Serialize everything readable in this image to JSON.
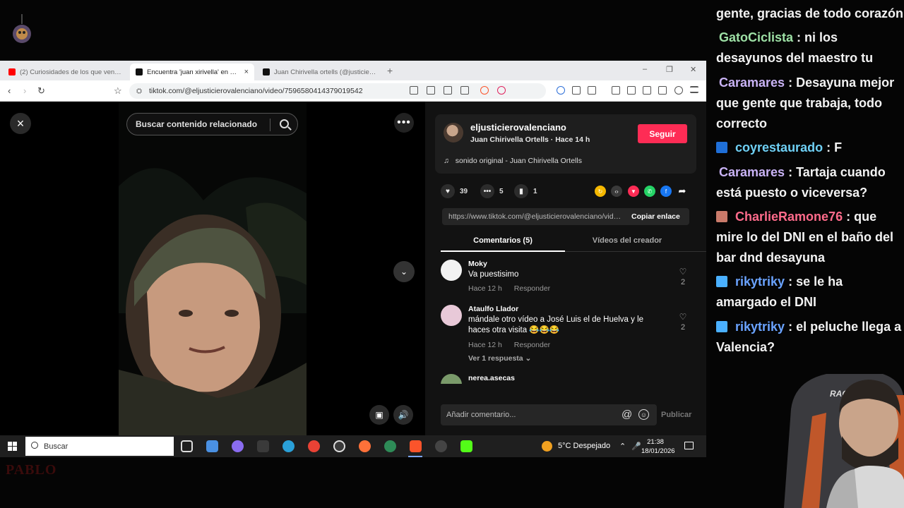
{
  "browser": {
    "tabs": [
      {
        "title": "(2) Curiosidades de los que ven mi contenido",
        "close": "",
        "color": "#ff0000"
      },
      {
        "title": "Encuentra 'juan xirivella' en TikTok",
        "close": "×",
        "color": "#111111"
      },
      {
        "title": "Juan Chirivella ortells (@justicierovalenciano)",
        "close": "",
        "color": "#111111"
      }
    ],
    "new_tab": "+",
    "window_controls": {
      "minimize": "–",
      "restore": "❐",
      "close": "✕"
    },
    "nav": {
      "back": "‹",
      "forward": "›",
      "reload": "↻",
      "bookmark": "☆"
    },
    "url": "tiktok.com/@eljusticierovalenciano/video/7596580414379019542",
    "url_icon": "site-info-icon"
  },
  "tiktok": {
    "close_label": "×",
    "search_placeholder": "Buscar contenido relacionado",
    "more_label": "•••",
    "down_label": "⌄",
    "author": {
      "handle": "eljusticierovalenciano",
      "subtitle": "Juan Chirivella Ortells · Hace 14 h",
      "follow_label": "Seguir",
      "music": "sonido original - Juan Chirivella Ortells"
    },
    "stats": {
      "likes": "39",
      "comments": "5",
      "saves": "1"
    },
    "share_colors": [
      "#f5b800",
      "#3a3a3a",
      "#fe2c55",
      "#25d366",
      "#1877f2"
    ],
    "copy": {
      "url": "https://www.tiktok.com/@eljusticierovalenciano/video/7596580414379019542",
      "button": "Copiar enlace"
    },
    "tabs": {
      "comments": "Comentarios (5)",
      "creator_videos": "Vídeos del creador"
    },
    "comments": [
      {
        "name": "Moky",
        "text": "Va puestisimo",
        "time": "Hace 12 h",
        "reply": "Responder",
        "likes": "2",
        "avatar_color": "#f2f2f2"
      },
      {
        "name": "Ataulfo Llador",
        "text": "mándale otro vídeo a José Luis el de Huelva y le haces otra visita 😂😂😂",
        "time": "Hace 12 h",
        "reply": "Responder",
        "likes": "2",
        "avatar_color": "#e8c9d8",
        "replies": "Ver 1 respuesta ⌄"
      },
      {
        "name": "nerea.asecas",
        "text": "",
        "time": "",
        "reply": "",
        "likes": "",
        "avatar_color": "#7a9a6a"
      }
    ],
    "add_comment_placeholder": "Añadir comentario...",
    "at_symbol": "@",
    "emoji_symbol": "☺",
    "publish_label": "Publicar"
  },
  "taskbar": {
    "search_label": "Buscar",
    "weather": "5°C  Despejado",
    "time": "21:38",
    "date": "18/01/2026",
    "app_colors": [
      "#8a6cf0",
      "#3a3a3a",
      "#2aa0d8",
      "#e94235",
      "#3a3a3a",
      "#ff7139",
      "#2e8b57",
      "#fb542b",
      "#444444",
      "#53fc18"
    ]
  },
  "chat": [
    {
      "user": "",
      "text": "gente, gracias de todo corazón",
      "color": "#f2f2f2",
      "badge": ""
    },
    {
      "user": "GatoCiclista",
      "text": ": ni los desayunos del maestro tu",
      "color": "#9de0a5",
      "badge": ""
    },
    {
      "user": "Caramares",
      "text": ": Desayuna mejor que gente que trabaja, todo correcto",
      "color": "#c9b3f5",
      "badge": ""
    },
    {
      "user": "coyrestaurado",
      "text": ": F",
      "color": "#6fd0f5",
      "badge": "#1f6fd8"
    },
    {
      "user": "Caramares",
      "text": ": Tartaja cuando está puesto o viceversa?",
      "color": "#c9b3f5",
      "badge": ""
    },
    {
      "user": "CharlieRamone76",
      "text": ": que mire lo del DNI en el baño del bar dnd desayuna",
      "color": "#ff6b8b",
      "badge": "#c97a6a"
    },
    {
      "user": "rikytriky",
      "text": ": se le ha amargado el DNI",
      "color": "#6aa3ff",
      "badge": "#4ab0ff"
    },
    {
      "user": "rikytriky",
      "text": ": el peluche llega a Valencia?",
      "color": "#6aa3ff",
      "badge": "#4ab0ff"
    }
  ],
  "stream": {
    "logo_text": "PABLO"
  }
}
